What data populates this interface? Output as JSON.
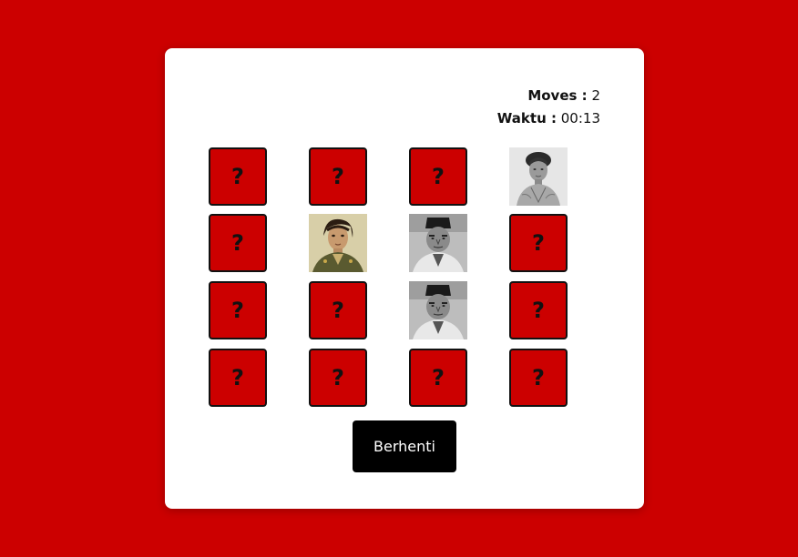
{
  "stats": {
    "moves_label": "Moves :",
    "moves_value": "2",
    "time_label": "Waktu :",
    "time_value": "00:13"
  },
  "cards": {
    "hidden_symbol": "?"
  },
  "grid": {
    "rows": 4,
    "columns": 4,
    "revealed": [
      {
        "row": 1,
        "col": 4,
        "image": "portrait-woman-kebaya-grayscale"
      },
      {
        "row": 2,
        "col": 2,
        "image": "portrait-woman-military-uniform-color"
      },
      {
        "row": 2,
        "col": 3,
        "image": "portrait-man-peci-grayscale"
      },
      {
        "row": 3,
        "col": 3,
        "image": "portrait-man-peci-grayscale"
      }
    ]
  },
  "button": {
    "stop_label": "Berhenti"
  },
  "colors": {
    "background": "#cc0000",
    "card_back": "#cc0000",
    "button": "#000000"
  }
}
